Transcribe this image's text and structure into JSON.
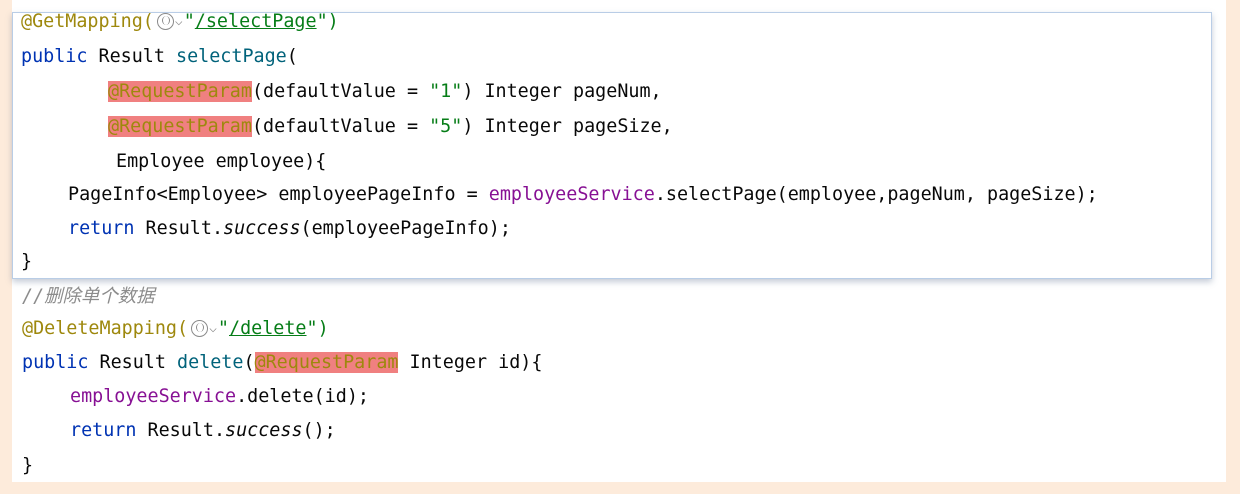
{
  "lines": {
    "l1": {
      "ann": "@GetMapping(",
      "open_quote": "\"",
      "url": "/selectPage",
      "close": "\")"
    },
    "l2": {
      "kw": "public",
      "type": " Result ",
      "fn": "selectPage",
      "rest": "("
    },
    "l3": {
      "ann": "@RequestParam",
      "a": "(defaultValue = ",
      "str": "\"1\"",
      "b": ") Integer pageNum,"
    },
    "l4": {
      "ann": "@RequestParam",
      "a": "(defaultValue = ",
      "str": "\"5\"",
      "b": ") Integer pageSize,"
    },
    "l5": {
      "text": "Employee employee){"
    },
    "l6": {
      "a": "PageInfo<Employee> employeePageInfo = ",
      "field": "employeeService",
      "b": ".selectPage(employee,pageNum, pageSize);"
    },
    "l7": {
      "kw": "return",
      "a": " Result.",
      "ital": "success",
      "b": "(employeePageInfo);"
    },
    "l8": {
      "text": "}"
    },
    "l9": {
      "comment": "//删除单个数据"
    },
    "l10": {
      "ann": "@DeleteMapping(",
      "open_quote": "\"",
      "url": "/delete",
      "close": "\")"
    },
    "l11": {
      "kw": "public",
      "a": " Result ",
      "fn": "delete",
      "paren": "(",
      "ann": "@RequestParam",
      "b": " Integer id){"
    },
    "l12": {
      "field": "employeeService",
      "a": ".delete(id);"
    },
    "l13": {
      "kw": "return",
      "a": " Result.",
      "ital": "success",
      "b": "();"
    },
    "l14": {
      "text": "}"
    }
  },
  "icons": {
    "globe": "globe-icon",
    "chevron": "chevron-down-icon"
  },
  "colors": {
    "background": "#fdebdb",
    "keyword": "#0033b3",
    "annotation": "#9e880d",
    "string": "#067d17",
    "method": "#00627a",
    "field": "#871094",
    "highlight": "#f08080",
    "comment": "#8c8c8c"
  }
}
